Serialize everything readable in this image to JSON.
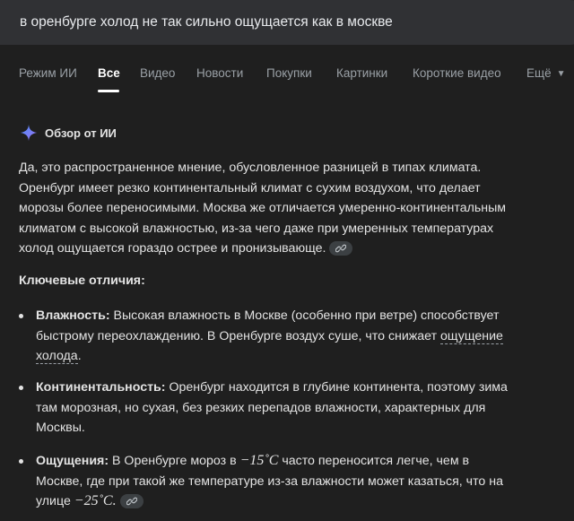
{
  "search": {
    "query": "в оренбурге холод не так сильно ощущается как в москве"
  },
  "tabs": [
    {
      "label": "Режим ИИ",
      "active": false
    },
    {
      "label": "Все",
      "active": true
    },
    {
      "label": "Видео",
      "active": false
    },
    {
      "label": "Новости",
      "active": false
    },
    {
      "label": "Покупки",
      "active": false
    },
    {
      "label": "Картинки",
      "active": false
    },
    {
      "label": "Короткие видео",
      "active": false
    },
    {
      "label": "Ещё",
      "active": false
    }
  ],
  "ai_overview": {
    "title": "Обзор от ИИ",
    "intro_lines": [
      "Да, это распространенное мнение, обусловленное разницей в типах климата.",
      "Оренбург имеет резко континентальный климат с сухим воздухом, что делает",
      "морозы более переносимыми. Москва же отличается умеренно-континентальным",
      "климатом с высокой влажностью, из-за чего даже при умеренных температурах",
      "холод ощущается гораздо острее и пронизывающе."
    ],
    "key_diff_title": "Ключевые отличия:",
    "items": [
      {
        "term": "Влажность:",
        "line1": " Высокая влажность в Москве (особенно при ветре) способствует",
        "line2_pre": "быстрому переохлаждению. В Оренбурге воздух суше, что снижает ",
        "line2_link": "ощущение",
        "line3": "холода"
      },
      {
        "term": "Континентальность:",
        "line1": " Оренбург находится в глубине континента, поэтому зима",
        "line2": "там морозная, но сухая, без резких перепадов влажности, характерных для",
        "line3": "Москвы."
      },
      {
        "term": "Ощущения:",
        "line1_pre": " В Оренбурге мороз в ",
        "temp1": "−15˚C",
        "line1_post": " часто переносится легче, чем в",
        "line2": "Москве, где при такой же температуре из-за влажности может казаться, что на",
        "line3_pre": "улице ",
        "temp2": "−25˚C"
      }
    ]
  },
  "colors": {
    "background": "#1f1f1f",
    "search_bar": "#303134",
    "text": "#e3e3e3",
    "muted": "#9aa0a6",
    "sparkle": "#4c8df6"
  },
  "icons": {
    "sparkle": "sparkle-icon",
    "link": "link-icon",
    "caret": "caret-down-icon"
  }
}
